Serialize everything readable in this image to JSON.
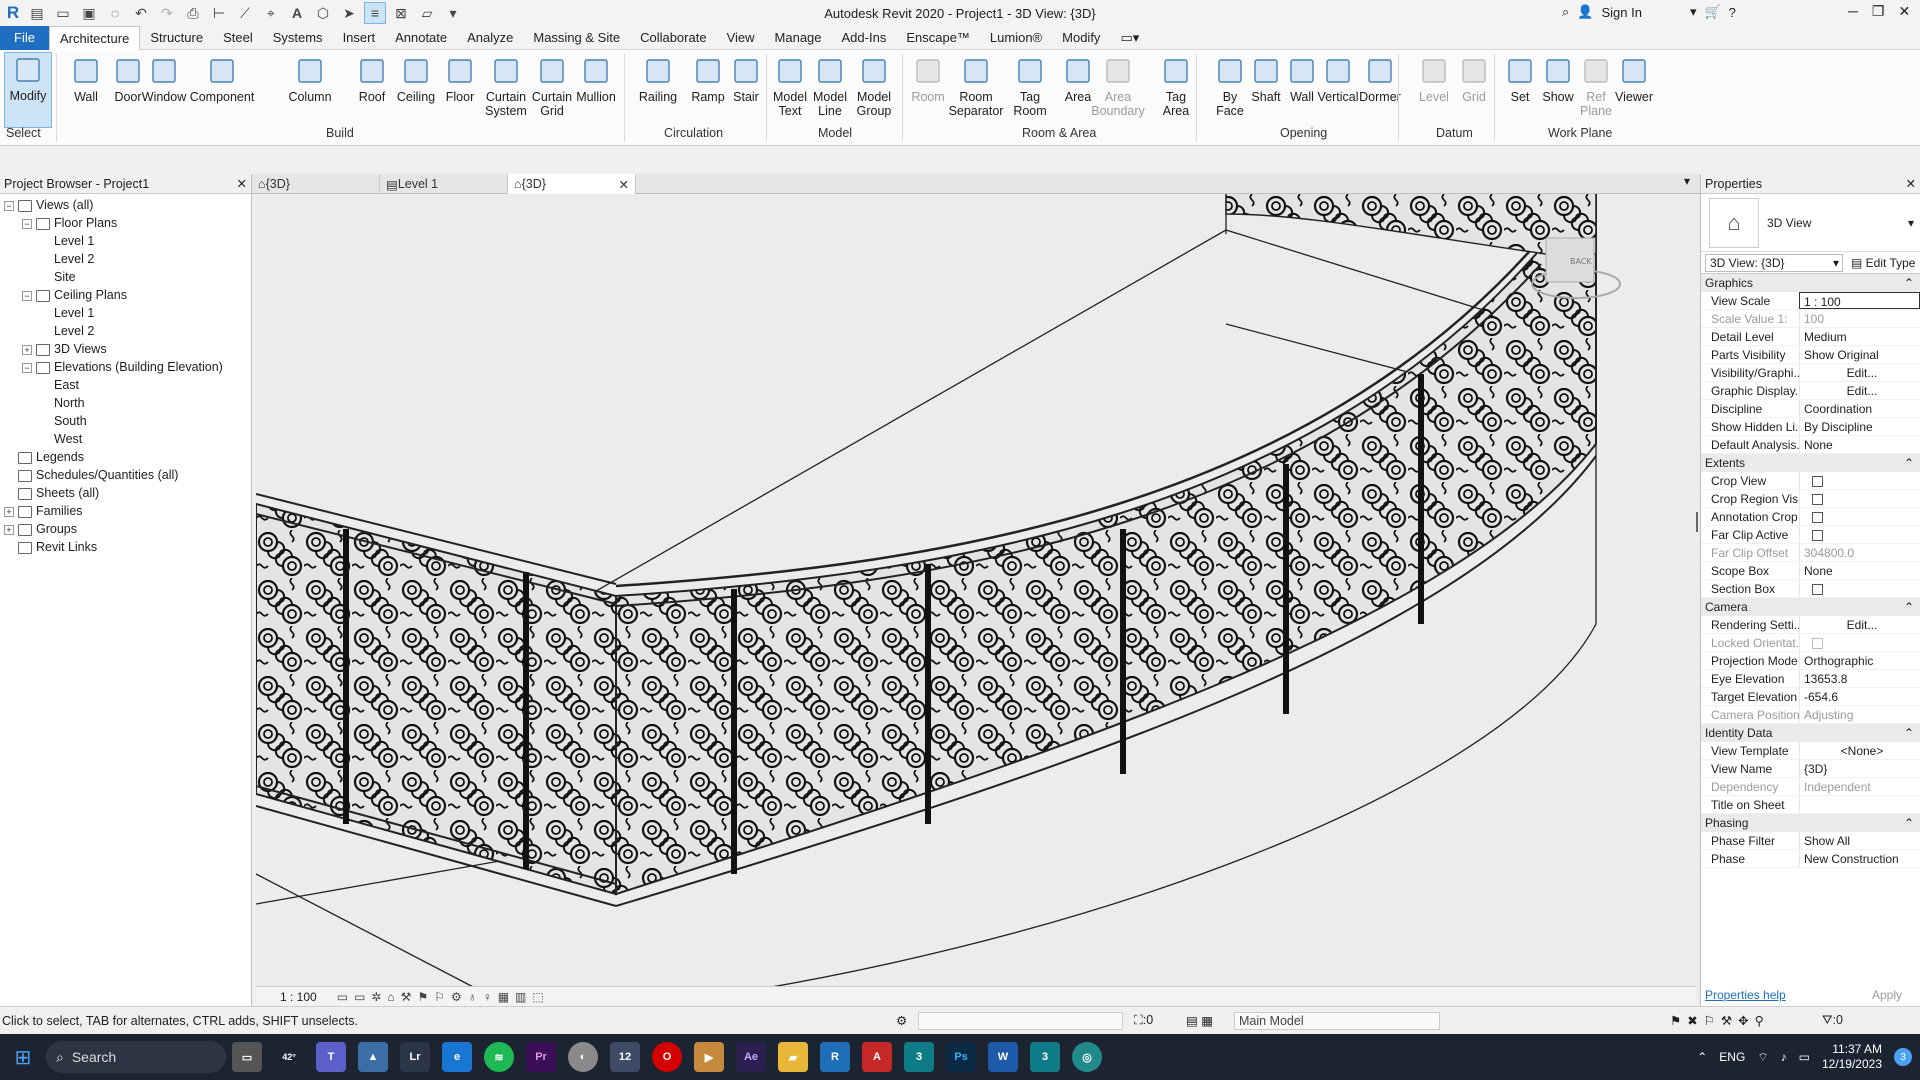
{
  "title_bar": {
    "title": "Autodesk Revit 2020 - Project1 - 3D View: {3D}",
    "sign_in": "Sign In"
  },
  "menu_tabs": [
    "File",
    "Architecture",
    "Structure",
    "Steel",
    "Systems",
    "Insert",
    "Annotate",
    "Analyze",
    "Massing & Site",
    "Collaborate",
    "View",
    "Manage",
    "Add-Ins",
    "Enscape™",
    "Lumion®",
    "Modify"
  ],
  "ribbon": {
    "select_label": "Select",
    "tools": [
      {
        "label": "Modify",
        "icon": "modify-cursor-icon"
      },
      {
        "label": "Wall",
        "icon": "wall-icon"
      },
      {
        "label": "Door",
        "icon": "door-icon"
      },
      {
        "label": "Window",
        "icon": "window-icon"
      },
      {
        "label": "Component",
        "icon": "component-icon"
      },
      {
        "label": "Column",
        "icon": "column-icon"
      },
      {
        "label": "Roof",
        "icon": "roof-icon"
      },
      {
        "label": "Ceiling",
        "icon": "ceiling-icon"
      },
      {
        "label": "Floor",
        "icon": "floor-icon"
      },
      {
        "label": "Curtain System",
        "icon": "curtain-system-icon"
      },
      {
        "label": "Curtain Grid",
        "icon": "curtain-grid-icon"
      },
      {
        "label": "Mullion",
        "icon": "mullion-icon"
      },
      {
        "label": "Railing",
        "icon": "railing-icon"
      },
      {
        "label": "Ramp",
        "icon": "ramp-icon"
      },
      {
        "label": "Stair",
        "icon": "stair-icon"
      },
      {
        "label": "Model Text",
        "icon": "model-text-icon"
      },
      {
        "label": "Model Line",
        "icon": "model-line-icon"
      },
      {
        "label": "Model Group",
        "icon": "model-group-icon"
      },
      {
        "label": "Room",
        "icon": "room-icon",
        "disabled": true
      },
      {
        "label": "Room Separator",
        "icon": "room-separator-icon"
      },
      {
        "label": "Tag Room",
        "icon": "tag-room-icon"
      },
      {
        "label": "Area",
        "icon": "area-icon"
      },
      {
        "label": "Area Boundary",
        "icon": "area-boundary-icon",
        "disabled": true
      },
      {
        "label": "Tag Area",
        "icon": "tag-area-icon"
      },
      {
        "label": "By Face",
        "icon": "by-face-icon"
      },
      {
        "label": "Shaft",
        "icon": "shaft-icon"
      },
      {
        "label": "Wall",
        "icon": "wall-opening-icon"
      },
      {
        "label": "Vertical",
        "icon": "vertical-icon"
      },
      {
        "label": "Dormer",
        "icon": "dormer-icon"
      },
      {
        "label": "Level",
        "icon": "level-icon",
        "disabled": true
      },
      {
        "label": "Grid",
        "icon": "grid-icon",
        "disabled": true
      },
      {
        "label": "Set",
        "icon": "set-icon"
      },
      {
        "label": "Show",
        "icon": "show-icon"
      },
      {
        "label": "Ref Plane",
        "icon": "ref-plane-icon",
        "disabled": true
      },
      {
        "label": "Viewer",
        "icon": "viewer-icon"
      }
    ],
    "panels": [
      "Build",
      "Circulation",
      "Model",
      "Room & Area",
      "Opening",
      "Datum",
      "Work Plane"
    ]
  },
  "project_browser": {
    "title": "Project Browser - Project1",
    "items": [
      {
        "label": "Views (all)",
        "level": 0,
        "toggle": "−"
      },
      {
        "label": "Floor Plans",
        "level": 1,
        "toggle": "−"
      },
      {
        "label": "Level 1",
        "level": 2
      },
      {
        "label": "Level 2",
        "level": 2
      },
      {
        "label": "Site",
        "level": 2
      },
      {
        "label": "Ceiling Plans",
        "level": 1,
        "toggle": "−"
      },
      {
        "label": "Level 1",
        "level": 2
      },
      {
        "label": "Level 2",
        "level": 2
      },
      {
        "label": "3D Views",
        "level": 1,
        "toggle": "+"
      },
      {
        "label": "Elevations (Building Elevation)",
        "level": 1,
        "toggle": "−"
      },
      {
        "label": "East",
        "level": 2
      },
      {
        "label": "North",
        "level": 2
      },
      {
        "label": "South",
        "level": 2
      },
      {
        "label": "West",
        "level": 2
      },
      {
        "label": "Legends",
        "level": 0
      },
      {
        "label": "Schedules/Quantities (all)",
        "level": 0
      },
      {
        "label": "Sheets (all)",
        "level": 0
      },
      {
        "label": "Families",
        "level": 0,
        "toggle": "+"
      },
      {
        "label": "Groups",
        "level": 0,
        "toggle": "+"
      },
      {
        "label": "Revit Links",
        "level": 0
      }
    ]
  },
  "view_tabs": [
    {
      "label": "{3D}",
      "active": false
    },
    {
      "label": "Level 1",
      "active": false
    },
    {
      "label": "{3D}",
      "active": true
    }
  ],
  "view_bar": {
    "scale": "1 : 100"
  },
  "properties": {
    "title": "Properties",
    "type_name": "3D View",
    "selector": "3D View: {3D}",
    "edit_type": "Edit Type",
    "sections": [
      {
        "name": "Graphics",
        "rows": [
          {
            "k": "View Scale",
            "v": "1 : 100"
          },
          {
            "k": "Scale Value 1:",
            "v": "100",
            "dim": true
          },
          {
            "k": "Detail Level",
            "v": "Medium"
          },
          {
            "k": "Parts Visibility",
            "v": "Show Original"
          },
          {
            "k": "Visibility/Graphi...",
            "v": "Edit...",
            "btn": true
          },
          {
            "k": "Graphic Display...",
            "v": "Edit...",
            "btn": true
          },
          {
            "k": "Discipline",
            "v": "Coordination"
          },
          {
            "k": "Show Hidden Li...",
            "v": "By Discipline"
          },
          {
            "k": "Default Analysis...",
            "v": "None"
          }
        ]
      },
      {
        "name": "Extents",
        "rows": [
          {
            "k": "Crop View",
            "chk": true
          },
          {
            "k": "Crop Region Vis...",
            "chk": true
          },
          {
            "k": "Annotation Crop",
            "chk": true
          },
          {
            "k": "Far Clip Active",
            "chk": true
          },
          {
            "k": "Far Clip Offset",
            "v": "304800.0",
            "dim": true
          },
          {
            "k": "Scope Box",
            "v": "None"
          },
          {
            "k": "Section Box",
            "chk": true
          }
        ]
      },
      {
        "name": "Camera",
        "rows": [
          {
            "k": "Rendering Setti...",
            "v": "Edit...",
            "btn": true
          },
          {
            "k": "Locked Orientat...",
            "chk": true,
            "dim": true
          },
          {
            "k": "Projection Mode",
            "v": "Orthographic"
          },
          {
            "k": "Eye Elevation",
            "v": "13653.8"
          },
          {
            "k": "Target Elevation",
            "v": "-654.6"
          },
          {
            "k": "Camera Position",
            "v": "Adjusting",
            "dim": true
          }
        ]
      },
      {
        "name": "Identity Data",
        "rows": [
          {
            "k": "View Template",
            "v": "<None>",
            "btn": true
          },
          {
            "k": "View Name",
            "v": "{3D}"
          },
          {
            "k": "Dependency",
            "v": "Independent",
            "dim": true
          },
          {
            "k": "Title on Sheet",
            "v": ""
          }
        ]
      },
      {
        "name": "Phasing",
        "rows": [
          {
            "k": "Phase Filter",
            "v": "Show All"
          },
          {
            "k": "Phase",
            "v": "New Construction"
          }
        ]
      }
    ],
    "help": "Properties help",
    "apply": "Apply"
  },
  "status": {
    "text": "Click to select, TAB for alternates, CTRL adds, SHIFT unselects.",
    "selection_count": ":0",
    "model": "Main Model",
    "filter_count": ":0"
  },
  "taskbar": {
    "search": "Search",
    "weather": "42°",
    "lang": "ENG",
    "time": "11:37 AM",
    "date": "12/19/2023",
    "notif": "3"
  }
}
